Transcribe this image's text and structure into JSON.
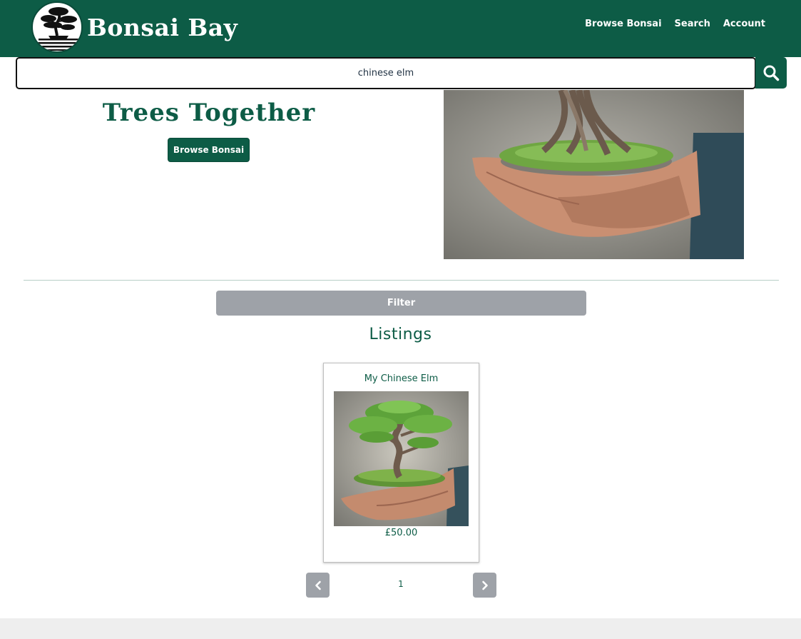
{
  "colors": {
    "brand": "#0d5c46",
    "button_grey": "#9ea2a8",
    "footer": "#eeeeee"
  },
  "header": {
    "brand_name": "Bonsai Bay",
    "logo_icon": "bonsai-tree-icon",
    "nav": [
      {
        "label": "Browse Bonsai"
      },
      {
        "label": "Search"
      },
      {
        "label": "Account"
      }
    ]
  },
  "search": {
    "value": "chinese elm",
    "button_icon": "search-icon"
  },
  "hero": {
    "title": "Trees Together",
    "button_label": "Browse Bonsai",
    "image": "hands-holding-bonsai-image"
  },
  "filter": {
    "label": "Filter"
  },
  "listings": {
    "title": "Listings",
    "items": [
      {
        "title": "My Chinese Elm",
        "price": "£50.00",
        "image": "bonsai-in-hands-image"
      }
    ]
  },
  "pagination": {
    "current_page": "1",
    "prev_icon": "chevron-left-icon",
    "next_icon": "chevron-right-icon"
  }
}
